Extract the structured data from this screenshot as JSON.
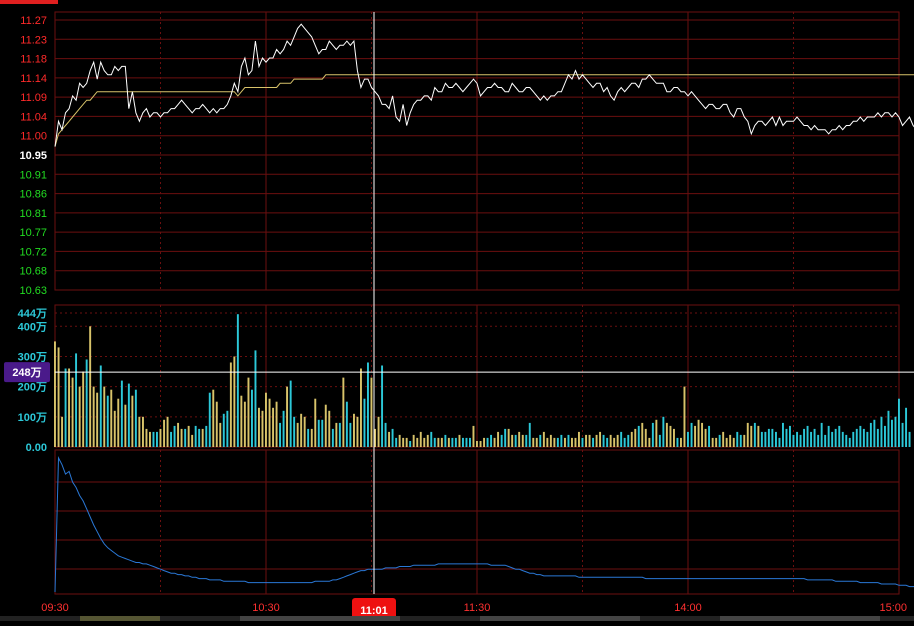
{
  "colors": {
    "background": "#000000",
    "grid": "#6b0f0f",
    "up": "#ff2a2a",
    "down": "#22dd22",
    "flat": "#ffffff",
    "price_line": "#ffffff",
    "avg_line": "#d8c36a",
    "vol_up": "#d8c36a",
    "vol_down": "#2cc8d8",
    "vol_axis": "#2cc8d8",
    "flow_line": "#2a78d6",
    "cursor": "#ffffff",
    "cursor_time_bg": "#ee1111",
    "cursor_vol_bg": "#4a1a8a",
    "time_text": "#ff3030"
  },
  "cursor": {
    "time_label": "11:01",
    "volume_label": "248万",
    "volume_value": 248
  },
  "chart_data": [
    {
      "type": "line",
      "name": "price",
      "y_ticks": [
        "11.27",
        "11.23",
        "11.18",
        "11.14",
        "11.09",
        "11.04",
        "11.00",
        "10.95",
        "10.91",
        "10.86",
        "10.81",
        "10.77",
        "10.72",
        "10.68",
        "10.63"
      ],
      "ylim": [
        10.63,
        11.27
      ],
      "x_ticks": [
        "09:30",
        "10:30",
        "11:30",
        "14:00",
        "15:00"
      ],
      "series": [
        {
          "key": "price",
          "values": [
            10.97,
            11.03,
            11.01,
            11.05,
            11.06,
            11.09,
            11.08,
            11.12,
            11.11,
            11.12,
            11.15,
            11.17,
            11.13,
            11.17,
            11.15,
            11.14,
            11.14,
            11.16,
            11.15,
            11.16,
            11.16,
            11.06,
            11.1,
            11.05,
            11.03,
            11.05,
            11.06,
            11.04,
            11.05,
            11.05,
            11.04,
            11.05,
            11.05,
            11.06,
            11.06,
            11.07,
            11.08,
            11.07,
            11.06,
            11.05,
            11.06,
            11.06,
            11.07,
            11.06,
            11.05,
            11.06,
            11.05,
            11.06,
            11.06,
            11.07,
            11.09,
            11.12,
            11.1,
            11.16,
            11.18,
            11.14,
            11.15,
            11.22,
            11.16,
            11.18,
            11.17,
            11.18,
            11.18,
            11.2,
            11.19,
            11.2,
            11.22,
            11.21,
            11.23,
            11.25,
            11.26,
            11.25,
            11.24,
            11.23,
            11.21,
            11.19,
            11.2,
            11.2,
            11.22,
            11.21,
            11.2,
            11.21,
            11.21,
            11.22,
            11.21,
            11.22,
            11.15,
            11.11,
            11.13,
            11.13,
            11.11,
            11.1,
            11.09,
            11.07,
            11.07,
            11.06,
            11.09,
            11.04,
            11.03,
            11.07,
            11.02,
            11.05,
            11.07,
            11.08,
            11.08,
            11.09,
            11.09,
            11.08,
            11.11,
            11.1,
            11.1,
            11.12,
            11.11,
            11.11,
            11.12,
            11.11,
            11.1,
            11.11,
            11.12,
            11.13,
            11.12,
            11.09,
            11.1,
            11.11,
            11.11,
            11.12,
            11.11,
            11.11,
            11.1,
            11.1,
            11.12,
            11.11,
            11.1,
            11.1,
            11.11,
            11.11,
            11.1,
            11.09,
            11.08,
            11.09,
            11.08,
            11.09,
            11.09,
            11.1,
            11.1,
            11.12,
            11.14,
            11.13,
            11.15,
            11.13,
            11.14,
            11.13,
            11.12,
            11.11,
            11.12,
            11.12,
            11.1,
            11.11,
            11.09,
            11.08,
            11.1,
            11.11,
            11.1,
            11.11,
            11.12,
            11.12,
            11.11,
            11.13,
            11.13,
            11.14,
            11.13,
            11.12,
            11.12,
            11.12,
            11.1,
            11.1,
            11.11,
            11.11,
            11.1,
            11.1,
            11.09,
            11.1,
            11.09,
            11.08,
            11.07,
            11.06,
            11.07,
            11.07,
            11.06,
            11.06,
            11.07,
            11.07,
            11.05,
            11.04,
            11.06,
            11.06,
            11.04,
            11.03,
            11.0,
            11.02,
            11.03,
            11.03,
            11.02,
            11.03,
            11.04,
            11.02,
            11.04,
            11.02,
            11.03,
            11.03,
            11.03,
            11.04,
            11.03,
            11.02,
            11.02,
            11.01,
            11.02,
            11.01,
            11.01,
            11.01,
            11.0,
            11.01,
            11.01,
            11.02,
            11.01,
            11.02,
            11.02,
            11.03,
            11.03,
            11.04,
            11.03,
            11.04,
            11.04,
            11.04,
            11.05,
            11.04,
            11.05,
            11.05,
            11.04,
            11.05,
            11.04,
            11.02,
            11.03,
            11.04,
            11.02,
            11.01,
            11.02,
            11.02,
            11.01,
            11.01,
            11.0,
            10.99,
            10.98,
            10.98,
            10.98,
            10.98,
            10.98,
            11.0
          ]
        },
        {
          "key": "average",
          "values": [
            10.97,
            11.0,
            11.01,
            11.02,
            11.03,
            11.04,
            11.05,
            11.06,
            11.07,
            11.08,
            11.08,
            11.09,
            11.1,
            11.1,
            11.1,
            11.1,
            11.1,
            11.1,
            11.1,
            11.1,
            11.1,
            11.1,
            11.1,
            11.1,
            11.1,
            11.1,
            11.1,
            11.1,
            11.1,
            11.1,
            11.1,
            11.1,
            11.1,
            11.1,
            11.1,
            11.1,
            11.1,
            11.1,
            11.1,
            11.1,
            11.1,
            11.1,
            11.1,
            11.1,
            11.1,
            11.1,
            11.1,
            11.1,
            11.1,
            11.1,
            11.1,
            11.1,
            11.09,
            11.1,
            11.11,
            11.11,
            11.11,
            11.11,
            11.11,
            11.11,
            11.11,
            11.11,
            11.11,
            11.11,
            11.12,
            11.12,
            11.12,
            11.12,
            11.13,
            11.13,
            11.13,
            11.13,
            11.13,
            11.13,
            11.13,
            11.13,
            11.13,
            11.14,
            11.14,
            11.14,
            11.14,
            11.14,
            11.14,
            11.14,
            11.14,
            11.14,
            11.14,
            11.14,
            11.14,
            11.14,
            11.14,
            11.14,
            11.14,
            11.14,
            11.14,
            11.14,
            11.14,
            11.14,
            11.14,
            11.14,
            11.14,
            11.14,
            11.14,
            11.14,
            11.14,
            11.14,
            11.14,
            11.14,
            11.14,
            11.14,
            11.14,
            11.14,
            11.14,
            11.14,
            11.14,
            11.14,
            11.14,
            11.14,
            11.14,
            11.14,
            11.14,
            11.14,
            11.14,
            11.14,
            11.14,
            11.14,
            11.14,
            11.14,
            11.14,
            11.14,
            11.14,
            11.14,
            11.14,
            11.14,
            11.14,
            11.14,
            11.14,
            11.14,
            11.14,
            11.14,
            11.14,
            11.14,
            11.14,
            11.14,
            11.14,
            11.14,
            11.14,
            11.14,
            11.14,
            11.14,
            11.14,
            11.14,
            11.14,
            11.14,
            11.14,
            11.14,
            11.14,
            11.14,
            11.14,
            11.14,
            11.14,
            11.14,
            11.14,
            11.14,
            11.14,
            11.14,
            11.14,
            11.14,
            11.14,
            11.14,
            11.14,
            11.14,
            11.14,
            11.14,
            11.14,
            11.14,
            11.14,
            11.14,
            11.14,
            11.14,
            11.14,
            11.14,
            11.14,
            11.14,
            11.14,
            11.14,
            11.14,
            11.14,
            11.14,
            11.14,
            11.14,
            11.14,
            11.14,
            11.14,
            11.14,
            11.14,
            11.14,
            11.14,
            11.14,
            11.14,
            11.14,
            11.14,
            11.14,
            11.14,
            11.14,
            11.14,
            11.14,
            11.14,
            11.14,
            11.14,
            11.14,
            11.14,
            11.14,
            11.14,
            11.14,
            11.14,
            11.14,
            11.14,
            11.14,
            11.14,
            11.14,
            11.14,
            11.14,
            11.14,
            11.14,
            11.14,
            11.14,
            11.14,
            11.14,
            11.14,
            11.14,
            11.14,
            11.14,
            11.14,
            11.14,
            11.14,
            11.14,
            11.14,
            11.14,
            11.14,
            11.14,
            11.14,
            11.14,
            11.14,
            11.14,
            11.14,
            11.14,
            11.14,
            11.14,
            11.14,
            11.14,
            11.14,
            11.14,
            11.14
          ]
        }
      ]
    },
    {
      "type": "bar",
      "name": "volume",
      "unit": "万",
      "y_ticks": [
        "444万",
        "400万",
        "300万",
        "200万",
        "100万",
        "0.00"
      ],
      "y_tick_values": [
        444,
        400,
        300,
        200,
        100,
        0
      ],
      "ylim": [
        0,
        444
      ],
      "values": [
        350,
        330,
        100,
        260,
        260,
        230,
        310,
        200,
        250,
        290,
        400,
        200,
        180,
        270,
        200,
        170,
        190,
        120,
        160,
        220,
        140,
        210,
        170,
        190,
        100,
        100,
        60,
        50,
        50,
        50,
        60,
        90,
        100,
        50,
        70,
        80,
        60,
        60,
        70,
        40,
        70,
        60,
        60,
        70,
        180,
        190,
        150,
        80,
        110,
        120,
        280,
        300,
        440,
        170,
        150,
        230,
        190,
        320,
        130,
        120,
        180,
        160,
        130,
        150,
        80,
        120,
        200,
        220,
        100,
        80,
        110,
        100,
        60,
        60,
        160,
        90,
        90,
        140,
        120,
        60,
        80,
        80,
        230,
        150,
        80,
        110,
        100,
        260,
        160,
        280,
        230,
        60,
        100,
        270,
        80,
        50,
        60,
        30,
        40,
        30,
        30,
        20,
        40,
        30,
        50,
        30,
        40,
        50,
        30,
        30,
        30,
        40,
        30,
        30,
        30,
        40,
        30,
        30,
        30,
        70,
        20,
        20,
        30,
        30,
        40,
        30,
        50,
        40,
        60,
        60,
        40,
        40,
        50,
        40,
        40,
        80,
        30,
        30,
        40,
        50,
        30,
        40,
        30,
        30,
        40,
        30,
        40,
        30,
        30,
        50,
        30,
        40,
        40,
        30,
        40,
        50,
        40,
        30,
        40,
        30,
        40,
        50,
        30,
        40,
        50,
        60,
        70,
        80,
        60,
        30,
        80,
        90,
        40,
        100,
        80,
        70,
        60,
        30,
        30,
        200,
        50,
        80,
        70,
        90,
        80,
        60,
        70,
        30,
        30,
        40,
        50,
        30,
        40,
        30,
        50,
        40,
        40,
        80,
        70,
        80,
        70,
        50,
        50,
        60,
        60,
        50,
        30,
        80,
        60,
        70,
        40,
        50,
        40,
        60,
        70,
        50,
        60,
        40,
        80,
        40,
        70,
        50,
        60,
        70,
        50,
        40,
        30,
        50,
        60,
        70,
        60,
        50,
        80,
        90,
        60,
        100,
        70,
        120,
        90,
        100,
        160,
        80,
        130,
        50
      ],
      "directions": "uuuduuduuduuududuuudududuuuudduuudduuduuddudduuudduuduuudduuuuuuddudduuuduudduudududduuudduuuddudduuuduuuuudduududduddduuuudduudduuduudduuduuuudduduuuduuduudduuuddduuduuududduuuduudduuuuduuduuuudduuudu"
    },
    {
      "type": "line",
      "name": "flow",
      "series": [
        {
          "key": "flow",
          "values": [
            0,
            100,
            95,
            88,
            90,
            82,
            78,
            72,
            68,
            62,
            56,
            50,
            45,
            40,
            36,
            33,
            31,
            29,
            27,
            26,
            25,
            24,
            23,
            22,
            22,
            21,
            21,
            20,
            19,
            18,
            17,
            16,
            15,
            14,
            14,
            13,
            13,
            12,
            12,
            11,
            11,
            10,
            10,
            10,
            9,
            9,
            9,
            9,
            8,
            8,
            8,
            8,
            8,
            8,
            8,
            7,
            7,
            7,
            7,
            7,
            7,
            7,
            7,
            7,
            7,
            7,
            7,
            7,
            7,
            7,
            7,
            7,
            7,
            7,
            8,
            8,
            8,
            8,
            8,
            9,
            9,
            10,
            11,
            12,
            13,
            14,
            15,
            16,
            16,
            17,
            17,
            17,
            17,
            17,
            18,
            18,
            18,
            18,
            19,
            19,
            19,
            19,
            20,
            20,
            20,
            20,
            20,
            20,
            20,
            21,
            21,
            21,
            21,
            21,
            21,
            21,
            21,
            21,
            21,
            21,
            21,
            21,
            21,
            21,
            20,
            20,
            20,
            20,
            20,
            19,
            18,
            17,
            17,
            16,
            15,
            14,
            14,
            13,
            13,
            12,
            12,
            12,
            12,
            12,
            12,
            12,
            12,
            12,
            12,
            11,
            11,
            11,
            11,
            11,
            11,
            11,
            11,
            11,
            11,
            11,
            11,
            11,
            11,
            11,
            11,
            11,
            11,
            11,
            10,
            10,
            10,
            10,
            10,
            10,
            10,
            10,
            10,
            10,
            10,
            10,
            10,
            10,
            10,
            10,
            10,
            10,
            10,
            10,
            10,
            10,
            10,
            10,
            10,
            10,
            10,
            10,
            10,
            10,
            10,
            10,
            10,
            10,
            10,
            10,
            10,
            10,
            10,
            10,
            10,
            10,
            10,
            10,
            10,
            10,
            9,
            9,
            9,
            9,
            9,
            9,
            9,
            9,
            8,
            8,
            8,
            8,
            8,
            8,
            8,
            7,
            7,
            7,
            7,
            7,
            7,
            6,
            6,
            6,
            6,
            6,
            5,
            5,
            5,
            4,
            4,
            4,
            4,
            3,
            3,
            3,
            3,
            2,
            2,
            2,
            2
          ]
        }
      ]
    }
  ]
}
